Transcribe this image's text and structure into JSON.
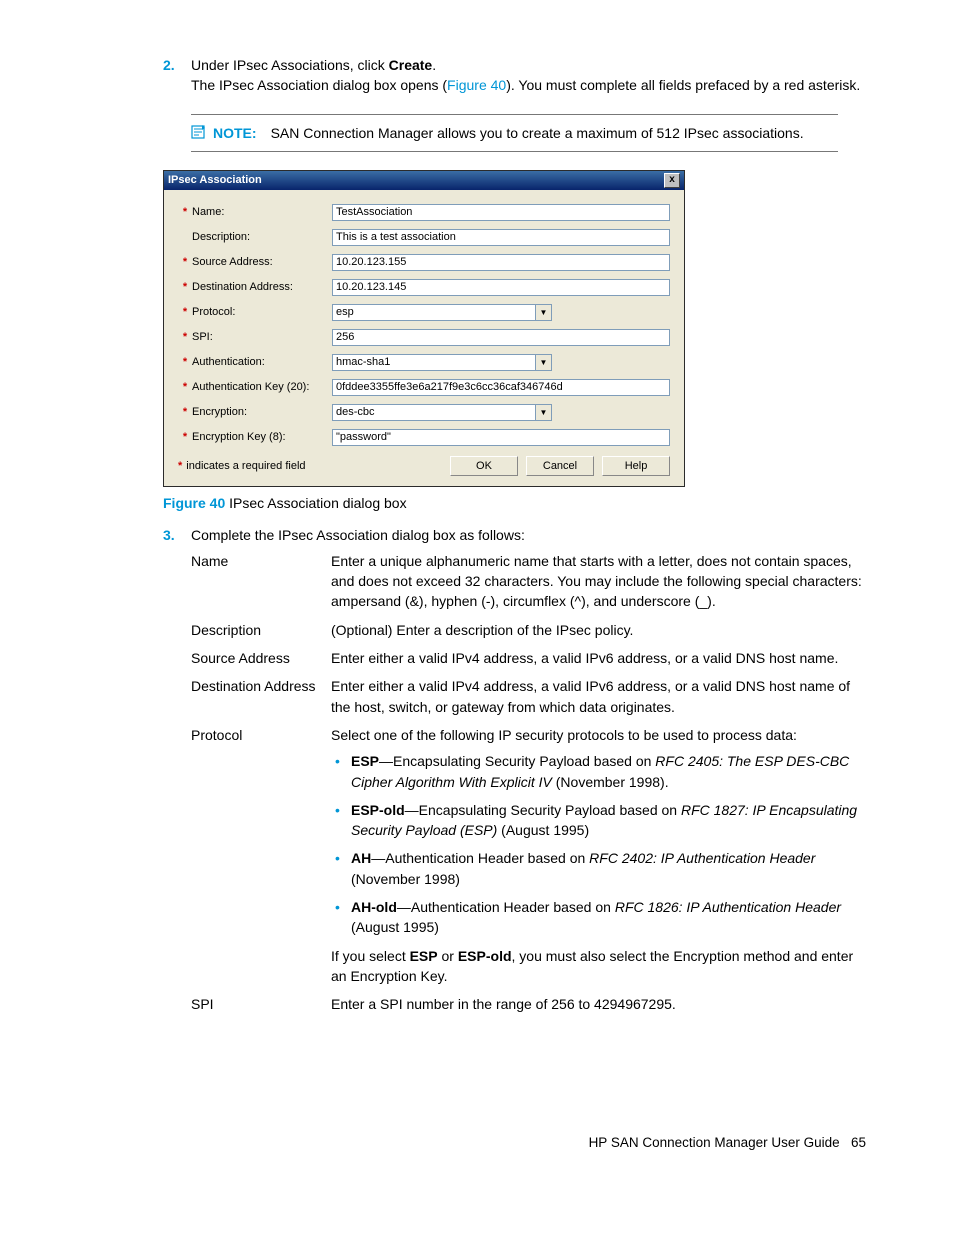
{
  "step2": {
    "num": "2.",
    "line1a": "Under IPsec Associations, click ",
    "line1b": "Create",
    "line1c": ".",
    "line2a": "The IPsec Association dialog box opens (",
    "line2link": "Figure 40",
    "line2b": "). You must complete all fields prefaced by a red asterisk."
  },
  "note": {
    "label": "NOTE:",
    "text": "SAN Connection Manager allows you to create a maximum of 512 IPsec associations."
  },
  "dialog": {
    "title": "IPsec Association",
    "close": "x",
    "rows": {
      "name": {
        "req": true,
        "label": "Name:",
        "value": "TestAssociation",
        "type": "text"
      },
      "desc": {
        "req": false,
        "label": "Description:",
        "value": "This is a test association",
        "type": "text"
      },
      "src": {
        "req": true,
        "label": "Source Address:",
        "value": "10.20.123.155",
        "type": "text"
      },
      "dst": {
        "req": true,
        "label": "Destination Address:",
        "value": "10.20.123.145",
        "type": "text"
      },
      "proto": {
        "req": true,
        "label": "Protocol:",
        "value": "esp",
        "type": "select"
      },
      "spi": {
        "req": true,
        "label": "SPI:",
        "value": "256",
        "type": "text"
      },
      "auth": {
        "req": true,
        "label": "Authentication:",
        "value": "hmac-sha1",
        "type": "select"
      },
      "authkey": {
        "req": true,
        "label": "Authentication Key  (20):",
        "value": "0fddee3355ffe3e6a217f9e3c6cc36caf346746d",
        "type": "text"
      },
      "enc": {
        "req": true,
        "label": "Encryption:",
        "value": "des-cbc",
        "type": "select"
      },
      "enckey": {
        "req": true,
        "label": "Encryption Key (8):",
        "value": "\"password\"",
        "type": "text"
      }
    },
    "reqNote": "indicates a required field",
    "buttons": {
      "ok": "OK",
      "cancel": "Cancel",
      "help": "Help"
    }
  },
  "figcap": {
    "num": "Figure 40",
    "text": " IPsec Association dialog box"
  },
  "step3": {
    "num": "3.",
    "text": "Complete the IPsec Association dialog box as follows:"
  },
  "defs": {
    "name": {
      "term": "Name",
      "body": "Enter a unique alphanumeric name that starts with a letter, does not contain spaces, and does not exceed 32 characters. You may include the following special characters: ampersand (&), hyphen (-), circumflex (^), and underscore (_)."
    },
    "desc": {
      "term": "Description",
      "body": "(Optional) Enter a description of the IPsec policy."
    },
    "src": {
      "term": "Source Address",
      "body": "Enter either a valid IPv4 address, a valid IPv6 address, or a valid DNS host name."
    },
    "dst": {
      "term": "Destination Address",
      "body": "Enter either a valid IPv4 address, a valid IPv6 address, or a valid DNS host name of the host, switch, or gateway from which data originates."
    },
    "proto": {
      "term": "Protocol",
      "intro": "Select one of the following IP security protocols to be used to process data:",
      "items": {
        "esp": {
          "b": "ESP",
          "t1": "—Encapsulating Security Payload based on ",
          "i": "RFC 2405: The ESP DES-CBC Cipher Algorithm With Explicit IV",
          "t2": " (November 1998)."
        },
        "espold": {
          "b": "ESP-old",
          "t1": "—Encapsulating Security Payload based on ",
          "i": "RFC 1827: IP Encapsulating Security Payload (ESP)",
          "t2": " (August 1995)"
        },
        "ah": {
          "b": "AH",
          "t1": "—Authentication Header based on ",
          "i": "RFC 2402: IP Authentication Header",
          "t2": " (November 1998)"
        },
        "ahold": {
          "b": "AH-old",
          "t1": "—Authentication Header based on ",
          "i": "RFC 1826: IP Authentication Header",
          "t2": " (August 1995)"
        }
      },
      "outro1": "If you select ",
      "outroB1": "ESP",
      "outroMid": " or ",
      "outroB2": "ESP-old",
      "outro2": ", you must also select the Encryption method and enter an Encryption Key."
    },
    "spi": {
      "term": "SPI",
      "body": "Enter a SPI number in the range of 256 to 4294967295."
    }
  },
  "footer": {
    "title": "HP SAN Connection Manager User Guide",
    "page": "65"
  }
}
